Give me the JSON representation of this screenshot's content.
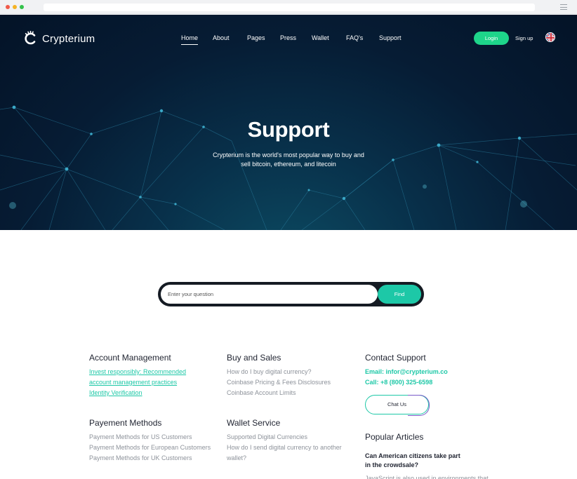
{
  "brand": {
    "name": "Crypterium"
  },
  "nav": {
    "items": [
      {
        "label": "Home",
        "active": true
      },
      {
        "label": "About"
      },
      {
        "label": "Pages"
      },
      {
        "label": "Press"
      },
      {
        "label": "Wallet"
      },
      {
        "label": "FAQ's"
      },
      {
        "label": "Support"
      }
    ],
    "login_label": "Login",
    "signup_label": "Sign up",
    "language_icon": "uk-flag-icon"
  },
  "hero": {
    "title": "Support",
    "subtitle": "Crypterium is the world's most popular way to buy and sell bitcoin, ethereum, and litecoin"
  },
  "search": {
    "placeholder": "Enter your question",
    "button_label": "Find"
  },
  "sections": {
    "account": {
      "title": "Account Management",
      "links": [
        "Invest responsibly: Recommended",
        "account management practices",
        "Identity Verification"
      ]
    },
    "buy_sales": {
      "title": "Buy and Sales",
      "links": [
        "How do I buy digital currency?",
        "Coinbase Pricing & Fees Disclosures",
        "Coinbase Account Limits"
      ]
    },
    "contact": {
      "title": "Contact Support",
      "email": "Email: infor@crypterium.co",
      "phone": "Call: +8 (800) 325-6598",
      "chat_label": "Chat Us"
    },
    "payment": {
      "title": "Payement Methods",
      "links": [
        "Payment Methods for US Customers",
        "Payment Methods for European Customers",
        "Payment Methods for UK Customers"
      ]
    },
    "wallet": {
      "title": "Wallet Service",
      "links": [
        "Supported Digital Currencies",
        "How do I send digital currency to another",
        "wallet?"
      ]
    },
    "popular": {
      "title": "Popular Articles",
      "article_title": "Can American citizens take part in the crowdsale?",
      "article_excerpt": "JavaScript is also used in environments that"
    }
  },
  "colors": {
    "accent": "#1dc8a7",
    "login": "#1ed58a",
    "hero_dark": "#061c34",
    "search_bar": "#151b23"
  }
}
